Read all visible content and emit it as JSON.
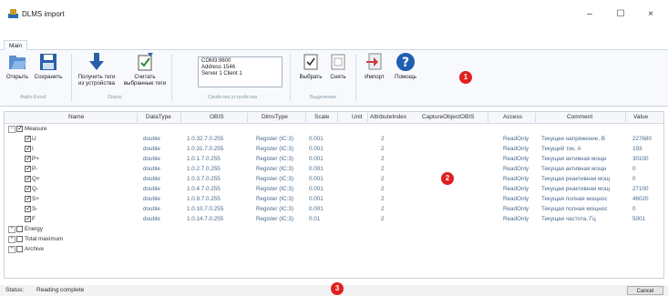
{
  "window": {
    "title": "DLMS import",
    "minimize": "–",
    "maximize": "☐",
    "close": "×"
  },
  "tabs": {
    "main": "Main"
  },
  "ribbon": {
    "open": "Открыть",
    "save": "Сохранить",
    "get_tags_line1": "Получить теги",
    "get_tags_line2": "из устройства",
    "read_tags_line1": "Считать",
    "read_tags_line2": "выбранные теги",
    "select": "Выбрать",
    "deselect": "Снять",
    "import": "Импорт",
    "help": "Помощь",
    "group_file": "Файл Excel",
    "group_poll": "Опрос",
    "group_device": "Свойства устройства",
    "group_select": "Выделение"
  },
  "device": {
    "line1": "COM3:9600",
    "line2": "Address 1546",
    "line3": "Server 1 Client 1"
  },
  "columns": [
    "Name",
    "DataType",
    "OBIS",
    "DlmsType",
    "Scale",
    "Unit",
    "AttributeIndex",
    "CaptureObjectOBIS",
    "Access",
    "Comment",
    "Value"
  ],
  "tree": {
    "measure": "Measure",
    "energy": "Energy",
    "total_max": "Total maximum",
    "archive": "Archive",
    "expand": "+",
    "collapse": "−"
  },
  "rows": [
    {
      "name": "U",
      "type": "double",
      "obis": "1.0.32.7.0.255",
      "dlms": "Register (IC:3)",
      "scale": "0.001",
      "attr": "2",
      "access": "ReadOnly",
      "comment": "Текущее напряжение, В",
      "value": "227680"
    },
    {
      "name": "I",
      "type": "double",
      "obis": "1.0.31.7.0.255",
      "dlms": "Register (IC:3)",
      "scale": "0.001",
      "attr": "2",
      "access": "ReadOnly",
      "comment": "Текущий ток, А",
      "value": "193"
    },
    {
      "name": "P+",
      "type": "double",
      "obis": "1.0.1.7.0.255",
      "dlms": "Register (IC:3)",
      "scale": "0.001",
      "attr": "2",
      "access": "ReadOnly",
      "comment": "Текущая активная мощн",
      "value": "30100"
    },
    {
      "name": "P-",
      "type": "double",
      "obis": "1.0.2.7.0.255",
      "dlms": "Register (IC:3)",
      "scale": "0.001",
      "attr": "2",
      "access": "ReadOnly",
      "comment": "Текущая активная мощн",
      "value": "0"
    },
    {
      "name": "Q+",
      "type": "double",
      "obis": "1.0.3.7.0.255",
      "dlms": "Register (IC:3)",
      "scale": "0.001",
      "attr": "2",
      "access": "ReadOnly",
      "comment": "Текущая реактивная мощ",
      "value": "0"
    },
    {
      "name": "Q-",
      "type": "double",
      "obis": "1.0.4.7.0.255",
      "dlms": "Register (IC:3)",
      "scale": "0.001",
      "attr": "2",
      "access": "ReadOnly",
      "comment": "Текущая реактивная мощ",
      "value": "27100"
    },
    {
      "name": "S+",
      "type": "double",
      "obis": "1.0.9.7.0.255",
      "dlms": "Register (IC:3)",
      "scale": "0.001",
      "attr": "2",
      "access": "ReadOnly",
      "comment": "Текущая полная мощнос",
      "value": "46020"
    },
    {
      "name": "S-",
      "type": "double",
      "obis": "1.0.10.7.0.255",
      "dlms": "Register (IC:3)",
      "scale": "0.001",
      "attr": "2",
      "access": "ReadOnly",
      "comment": "Текущая полная мощнос",
      "value": "0"
    },
    {
      "name": "F",
      "type": "double",
      "obis": "1.0.14.7.0.255",
      "dlms": "Register (IC:3)",
      "scale": "0.01",
      "attr": "2",
      "access": "ReadOnly",
      "comment": "Текущая частота, Гц",
      "value": "5001"
    }
  ],
  "status": {
    "label": "Status:",
    "text": "Reading complete"
  },
  "buttons": {
    "cancel": "Cancel"
  },
  "badges": {
    "b1": "1",
    "b2": "2",
    "b3": "3"
  },
  "colors": {
    "accent": "#2b6cb0",
    "badge": "#e02020",
    "value_text": "#4a6a8a"
  }
}
